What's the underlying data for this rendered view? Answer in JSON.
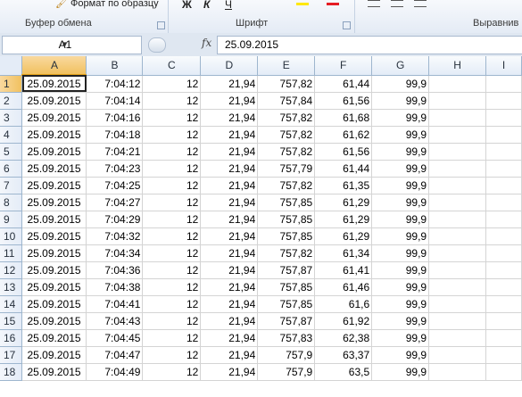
{
  "ribbon": {
    "clipboard_top_item": "Формат по образцу",
    "clipboard_label": "Буфер обмена",
    "font_label": "Шрифт",
    "alignment_label": "Выравнив"
  },
  "formula_bar": {
    "name_box": "A1",
    "fx_label": "fx",
    "formula": "25.09.2015"
  },
  "columns": [
    "A",
    "B",
    "C",
    "D",
    "E",
    "F",
    "G",
    "H",
    "I"
  ],
  "selected_cell": "A1",
  "rows": [
    {
      "n": "1",
      "a": "25.09.2015",
      "b": "7:04:12",
      "c": "12",
      "d": "21,94",
      "e": "757,82",
      "f": "61,44",
      "g": "99,9"
    },
    {
      "n": "2",
      "a": "25.09.2015",
      "b": "7:04:14",
      "c": "12",
      "d": "21,94",
      "e": "757,84",
      "f": "61,56",
      "g": "99,9"
    },
    {
      "n": "3",
      "a": "25.09.2015",
      "b": "7:04:16",
      "c": "12",
      "d": "21,94",
      "e": "757,82",
      "f": "61,68",
      "g": "99,9"
    },
    {
      "n": "4",
      "a": "25.09.2015",
      "b": "7:04:18",
      "c": "12",
      "d": "21,94",
      "e": "757,82",
      "f": "61,62",
      "g": "99,9"
    },
    {
      "n": "5",
      "a": "25.09.2015",
      "b": "7:04:21",
      "c": "12",
      "d": "21,94",
      "e": "757,82",
      "f": "61,56",
      "g": "99,9"
    },
    {
      "n": "6",
      "a": "25.09.2015",
      "b": "7:04:23",
      "c": "12",
      "d": "21,94",
      "e": "757,79",
      "f": "61,44",
      "g": "99,9"
    },
    {
      "n": "7",
      "a": "25.09.2015",
      "b": "7:04:25",
      "c": "12",
      "d": "21,94",
      "e": "757,82",
      "f": "61,35",
      "g": "99,9"
    },
    {
      "n": "8",
      "a": "25.09.2015",
      "b": "7:04:27",
      "c": "12",
      "d": "21,94",
      "e": "757,85",
      "f": "61,29",
      "g": "99,9"
    },
    {
      "n": "9",
      "a": "25.09.2015",
      "b": "7:04:29",
      "c": "12",
      "d": "21,94",
      "e": "757,85",
      "f": "61,29",
      "g": "99,9"
    },
    {
      "n": "10",
      "a": "25.09.2015",
      "b": "7:04:32",
      "c": "12",
      "d": "21,94",
      "e": "757,85",
      "f": "61,29",
      "g": "99,9"
    },
    {
      "n": "11",
      "a": "25.09.2015",
      "b": "7:04:34",
      "c": "12",
      "d": "21,94",
      "e": "757,82",
      "f": "61,34",
      "g": "99,9"
    },
    {
      "n": "12",
      "a": "25.09.2015",
      "b": "7:04:36",
      "c": "12",
      "d": "21,94",
      "e": "757,87",
      "f": "61,41",
      "g": "99,9"
    },
    {
      "n": "13",
      "a": "25.09.2015",
      "b": "7:04:38",
      "c": "12",
      "d": "21,94",
      "e": "757,85",
      "f": "61,46",
      "g": "99,9"
    },
    {
      "n": "14",
      "a": "25.09.2015",
      "b": "7:04:41",
      "c": "12",
      "d": "21,94",
      "e": "757,85",
      "f": "61,6",
      "g": "99,9"
    },
    {
      "n": "15",
      "a": "25.09.2015",
      "b": "7:04:43",
      "c": "12",
      "d": "21,94",
      "e": "757,87",
      "f": "61,92",
      "g": "99,9"
    },
    {
      "n": "16",
      "a": "25.09.2015",
      "b": "7:04:45",
      "c": "12",
      "d": "21,94",
      "e": "757,83",
      "f": "62,38",
      "g": "99,9"
    },
    {
      "n": "17",
      "a": "25.09.2015",
      "b": "7:04:47",
      "c": "12",
      "d": "21,94",
      "e": "757,9",
      "f": "63,37",
      "g": "99,9"
    },
    {
      "n": "18",
      "a": "25.09.2015",
      "b": "7:04:49",
      "c": "12",
      "d": "21,94",
      "e": "757,9",
      "f": "63,5",
      "g": "99,9"
    }
  ],
  "colors": {
    "selection_header": "#f1c15f",
    "header_bg": "#e4ecf7",
    "ribbon_bg": "#e4ebf5"
  }
}
